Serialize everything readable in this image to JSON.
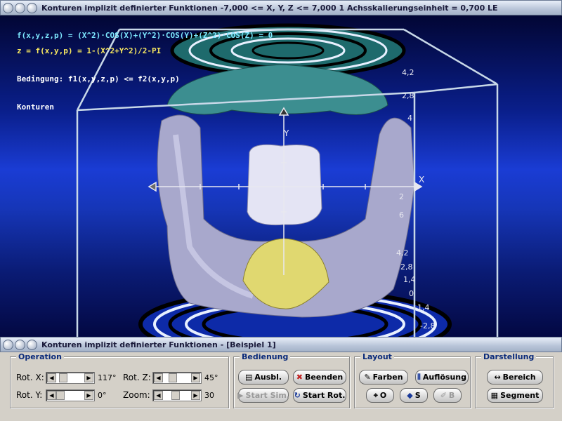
{
  "main_window": {
    "title": "Konturen implizit definierter Funktionen   -7,000 <= X, Y, Z <= 7,000    1 Achsskalierungseinheit = 0,700 LE"
  },
  "viewport": {
    "formula_line1": "f(x,y,z,p) = (X^2)·COS(X)+(Y^2)·COS(Y)+(Z^2)·COS(Z) = 0",
    "formula_line2": "z = f(x,y,p) = 1-(X^2+Y^2)/2-PI",
    "condition": "Bedingung: f1(x,y,z,p) <= f2(x,y,p)",
    "mode": "Konturen",
    "axis_x_label": "X",
    "axis_y_label": "Y",
    "axis_scale_labels": [
      "4,2",
      "2,8",
      "4",
      "2",
      "6",
      "4,2",
      "2,8",
      "1,4",
      "0",
      "-1,4",
      "-2,8"
    ],
    "colors": {
      "background_top": "#020634",
      "background_mid": "#1a3cd4",
      "surface_gray": "#b8b8d8",
      "surface_teal": "#2a7a7a",
      "surface_yellow": "#e8e070"
    }
  },
  "control_window": {
    "title": "Konturen implizit definierter Funktionen - [Beispiel 1]"
  },
  "operation": {
    "group_label": "Operation",
    "rot_x_label": "Rot. X:",
    "rot_x_value": "117°",
    "rot_y_label": "Rot. Y:",
    "rot_y_value": "0°",
    "rot_z_label": "Rot. Z:",
    "rot_z_value": "45°",
    "zoom_label": "Zoom:",
    "zoom_value": "30"
  },
  "bedienung": {
    "group_label": "Bedienung",
    "ausbl_label": "Ausbl.",
    "beenden_label": "Beenden",
    "start_sim_label": "Start Sim.",
    "start_rot_label": "Start Rot."
  },
  "layout": {
    "group_label": "Layout",
    "farben_label": "Farben",
    "aufloesung_label": "Auflösung",
    "o_label": "O",
    "s_label": "S",
    "b_label": "B"
  },
  "darstellung": {
    "group_label": "Darstellung",
    "bereich_label": "Bereich",
    "segment_label": "Segment"
  }
}
